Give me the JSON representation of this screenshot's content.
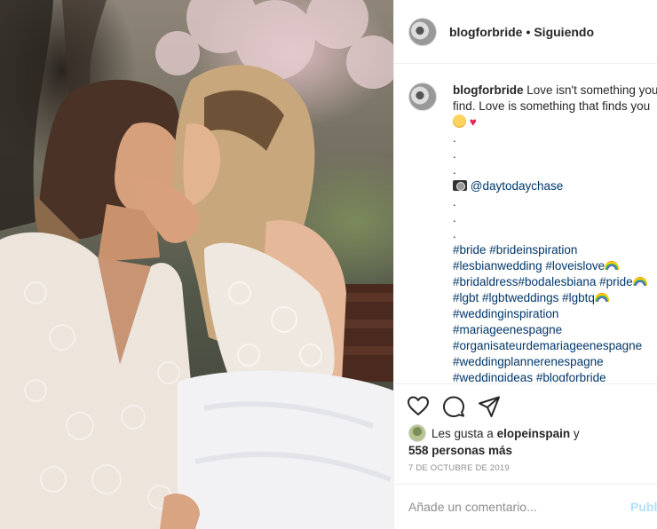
{
  "post": {
    "username": "blogforbride",
    "separator": "•",
    "follow_status": "Siguiendo"
  },
  "caption": {
    "username": "blogforbride",
    "text_line1": "Love isn't something you",
    "text_line2": "find. Love is something that finds you",
    "dots": [
      ".",
      ".",
      "."
    ],
    "credit_mention": "@daytodaychase",
    "dots2": [
      ".",
      ".",
      "."
    ],
    "hashtags": [
      [
        "#bride",
        "#brideinspiration"
      ],
      [
        "#lesbianwedding",
        "#loveislove"
      ],
      [
        "#bridaldress#bodalesbiana",
        "#pride"
      ],
      [
        "#lgbt",
        "#lgbtweddings",
        "#lgbtq"
      ],
      [
        "#weddinginspiration"
      ],
      [
        "#mariageenespagne"
      ],
      [
        "#organisateurdemariageenespagne"
      ],
      [
        "#weddingplannerenespagne"
      ],
      [
        "#weddingideas",
        "#blogforbride"
      ]
    ]
  },
  "likes": {
    "prefix": "Les gusta a",
    "user": "elopeinspain",
    "conj": "y",
    "count_text": "558 personas más"
  },
  "date": "7 DE OCTUBRE DE 2019",
  "comment_box": {
    "placeholder": "Añade un comentario...",
    "post_label": "Publicar"
  },
  "icons": {
    "like": "heart-icon",
    "comment": "comment-icon",
    "share": "share-icon"
  }
}
